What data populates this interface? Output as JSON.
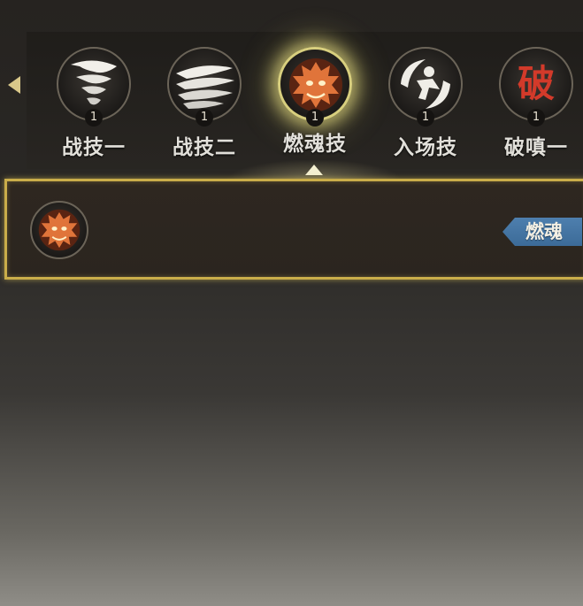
{
  "navigation": {
    "prev_icon": "arrow-left-icon"
  },
  "skills": [
    {
      "name": "战技一",
      "level": "1",
      "icon": "whirlwind-icon",
      "selected": false
    },
    {
      "name": "战技二",
      "level": "1",
      "icon": "claw-slash-icon",
      "selected": false
    },
    {
      "name": "燃魂技",
      "level": "1",
      "icon": "dragon-head-icon",
      "selected": true
    },
    {
      "name": "入场技",
      "level": "1",
      "icon": "dash-figure-icon",
      "selected": false
    },
    {
      "name": "破嗔一",
      "level": "1",
      "icon": "po-glyph-icon",
      "selected": false,
      "glyph": "破"
    }
  ],
  "detail": {
    "icon": "dragon-head-icon",
    "tag": "燃魂"
  },
  "colors": {
    "selected_border": "#d8cf7e",
    "panel_border": "#c9ad4a",
    "tag_blue": "#4e7fae",
    "dragon_orange": "#e0743a",
    "po_red": "#d23a2a"
  }
}
